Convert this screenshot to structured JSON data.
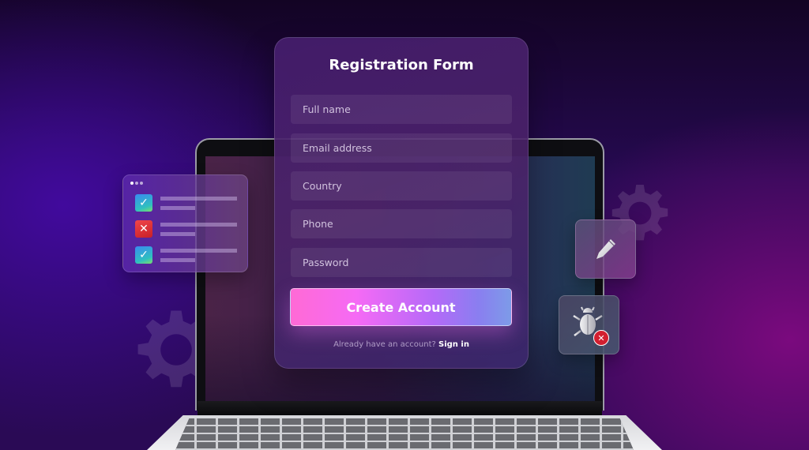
{
  "form": {
    "title": "Registration Form",
    "fields": [
      {
        "name": "full-name",
        "placeholder": "Full name"
      },
      {
        "name": "email",
        "placeholder": "Email address"
      },
      {
        "name": "country",
        "placeholder": "Country"
      },
      {
        "name": "phone",
        "placeholder": "Phone"
      },
      {
        "name": "password",
        "placeholder": "Password"
      }
    ],
    "submit_label": "Create Account",
    "signin_prompt": "Already have an account?",
    "signin_link": "Sign in",
    "button_gradient": [
      "#ff6ad5",
      "#b46af8",
      "#7d9be8"
    ]
  },
  "checklist": {
    "items": [
      {
        "status": "pass",
        "icon": "check-icon",
        "glyph": "✓"
      },
      {
        "status": "fail",
        "icon": "x-icon",
        "glyph": "✕"
      },
      {
        "status": "pass",
        "icon": "check-icon",
        "glyph": "✓"
      }
    ]
  },
  "tiles": {
    "edit_icon": "pencil-icon",
    "bug_icon": "bug-icon",
    "bug_badge_glyph": "✕"
  },
  "colors": {
    "background_dark": "#130424",
    "background_purple": "#2a0a55",
    "accent_magenta": "#960a8c",
    "fail_red": "#d21f30"
  }
}
